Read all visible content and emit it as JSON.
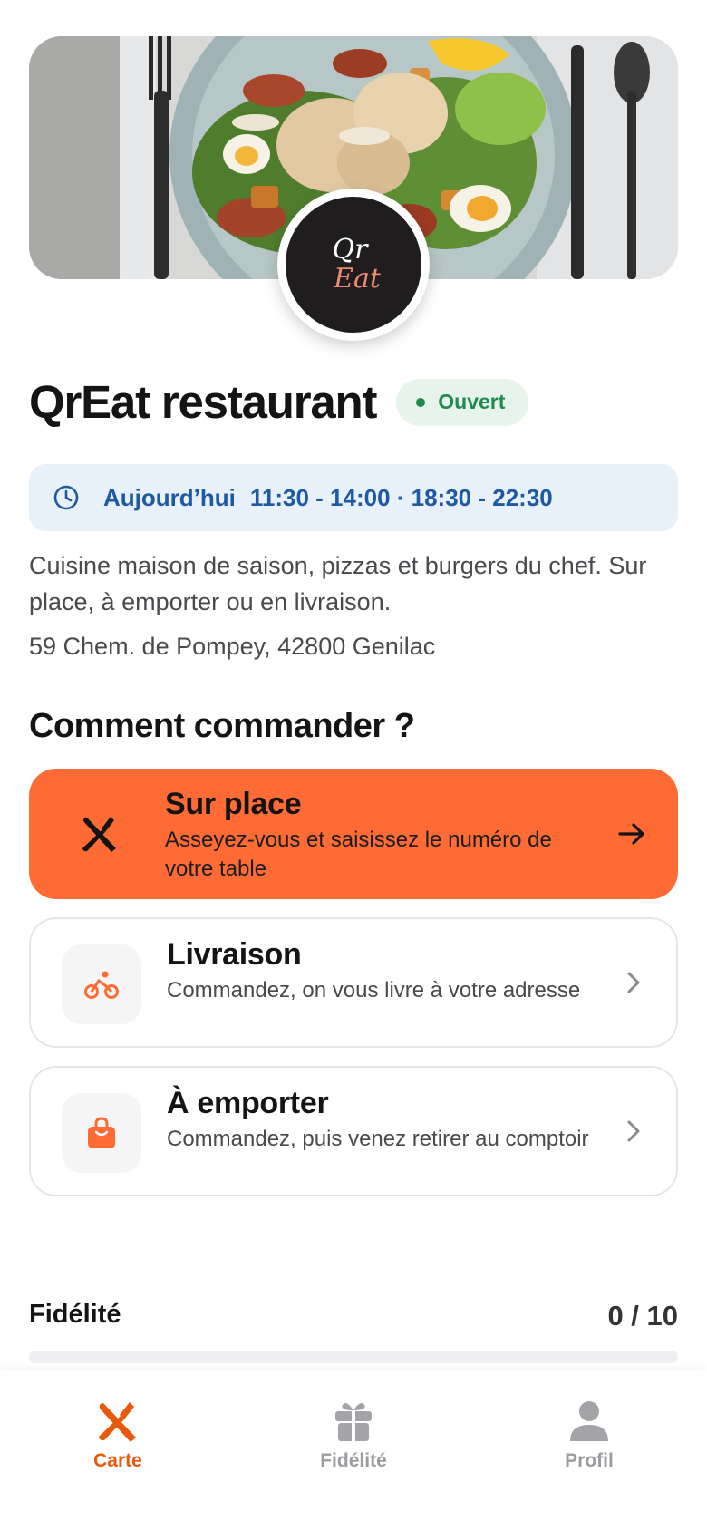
{
  "restaurant": {
    "name": "QrEat restaurant",
    "status": "Ouvert",
    "logo_line1": "Qr",
    "logo_line2": "Eat",
    "hours_day": "Aujourd’hui",
    "hours": "11:30 - 14:00 · 18:30 - 22:30",
    "description": "Cuisine maison de saison, pizzas et burgers du chef. Sur place, à emporter ou en livraison.",
    "address": "59 Chem. de Pompey, 42800 Genilac"
  },
  "order": {
    "section_title": "Comment commander ?",
    "options": [
      {
        "title": "Sur place",
        "subtitle": "Asseyez-vous et saisissez le numéro de votre table",
        "icon": "fork-knife-icon"
      },
      {
        "title": "Livraison",
        "subtitle": "Commandez, on vous livre à votre adresse",
        "icon": "bike-icon"
      },
      {
        "title": "À emporter",
        "subtitle": "Commandez, puis venez retirer au comptoir",
        "icon": "bag-icon"
      }
    ]
  },
  "loyalty": {
    "label": "Fidélité",
    "count": "0 / 10",
    "progress": 0
  },
  "tabbar": {
    "tabs": [
      {
        "label": "Carte",
        "icon": "fork-knife-icon",
        "active": true
      },
      {
        "label": "Fidélité",
        "icon": "gift-icon",
        "active": false
      },
      {
        "label": "Profil",
        "icon": "person-icon",
        "active": false
      }
    ]
  },
  "colors": {
    "accent": "#ff6b35",
    "accent_dark": "#e8590c",
    "open_green": "#1f8a4c",
    "hours_blue": "#1e5aa3"
  }
}
